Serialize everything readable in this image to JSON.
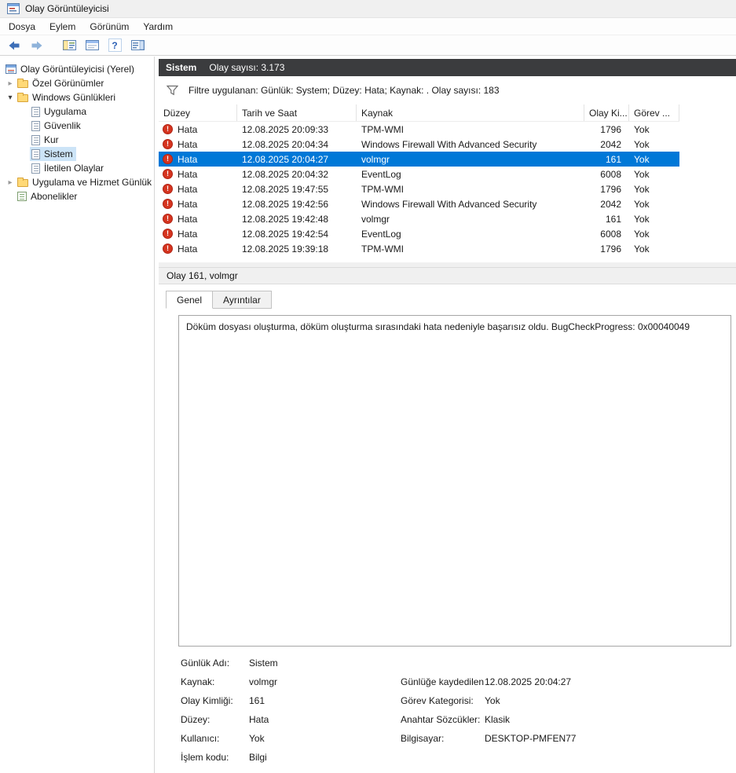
{
  "window": {
    "title": "Olay Görüntüleyicisi"
  },
  "menubar": {
    "items": [
      "Dosya",
      "Eylem",
      "Görünüm",
      "Yardım"
    ]
  },
  "toolbar": {
    "icons": [
      "back-icon",
      "forward-icon",
      "show-console-tree-icon",
      "properties-icon",
      "help-icon",
      "action-pane-icon"
    ]
  },
  "sidebar": {
    "items": [
      {
        "label": "Olay Görüntüleyicisi (Yerel)",
        "level": 0,
        "icon": "event-viewer",
        "expander": "none",
        "selected": false
      },
      {
        "label": "Özel Görünümler",
        "level": 1,
        "icon": "folder",
        "expander": "collapsed",
        "selected": false
      },
      {
        "label": "Windows Günlükleri",
        "level": 1,
        "icon": "folder",
        "expander": "expanded",
        "selected": false
      },
      {
        "label": "Uygulama",
        "level": 2,
        "icon": "log",
        "expander": "none",
        "selected": false
      },
      {
        "label": "Güvenlik",
        "level": 2,
        "icon": "log",
        "expander": "none",
        "selected": false
      },
      {
        "label": "Kur",
        "level": 2,
        "icon": "log",
        "expander": "none",
        "selected": false
      },
      {
        "label": "Sistem",
        "level": 2,
        "icon": "log",
        "expander": "none",
        "selected": true
      },
      {
        "label": "İletilen Olaylar",
        "level": 2,
        "icon": "log",
        "expander": "none",
        "selected": false
      },
      {
        "label": "Uygulama ve Hizmet Günlük",
        "level": 1,
        "icon": "folder",
        "expander": "collapsed",
        "selected": false
      },
      {
        "label": "Abonelikler",
        "level": 1,
        "icon": "subscriptions",
        "expander": "none",
        "selected": false
      }
    ]
  },
  "main": {
    "header": {
      "title": "Sistem",
      "count": "Olay sayısı: 3.173"
    },
    "filter": {
      "text": "Filtre uygulanan: Günlük: System; Düzey: Hata; Kaynak: . Olay sayısı: 183"
    },
    "table": {
      "columns": [
        "Düzey",
        "Tarih ve Saat",
        "Kaynak",
        "Olay Ki...",
        "Görev ..."
      ],
      "rows": [
        {
          "level": "Hata",
          "datetime": "12.08.2025 20:09:33",
          "source": "TPM-WMI",
          "event_id": "1796",
          "task": "Yok",
          "selected": false
        },
        {
          "level": "Hata",
          "datetime": "12.08.2025 20:04:34",
          "source": "Windows Firewall With Advanced Security",
          "event_id": "2042",
          "task": "Yok",
          "selected": false
        },
        {
          "level": "Hata",
          "datetime": "12.08.2025 20:04:27",
          "source": "volmgr",
          "event_id": "161",
          "task": "Yok",
          "selected": true
        },
        {
          "level": "Hata",
          "datetime": "12.08.2025 20:04:32",
          "source": "EventLog",
          "event_id": "6008",
          "task": "Yok",
          "selected": false
        },
        {
          "level": "Hata",
          "datetime": "12.08.2025 19:47:55",
          "source": "TPM-WMI",
          "event_id": "1796",
          "task": "Yok",
          "selected": false
        },
        {
          "level": "Hata",
          "datetime": "12.08.2025 19:42:56",
          "source": "Windows Firewall With Advanced Security",
          "event_id": "2042",
          "task": "Yok",
          "selected": false
        },
        {
          "level": "Hata",
          "datetime": "12.08.2025 19:42:48",
          "source": "volmgr",
          "event_id": "161",
          "task": "Yok",
          "selected": false
        },
        {
          "level": "Hata",
          "datetime": "12.08.2025 19:42:54",
          "source": "EventLog",
          "event_id": "6008",
          "task": "Yok",
          "selected": false
        },
        {
          "level": "Hata",
          "datetime": "12.08.2025 19:39:18",
          "source": "TPM-WMI",
          "event_id": "1796",
          "task": "Yok",
          "selected": false
        }
      ]
    }
  },
  "detail": {
    "header": "Olay 161, volmgr",
    "tabs": [
      {
        "label": "Genel",
        "active": true
      },
      {
        "label": "Ayrıntılar",
        "active": false
      }
    ],
    "description": "Döküm dosyası oluşturma, döküm oluşturma sırasındaki hata nedeniyle başarısız oldu. BugCheckProgress: 0x00040049",
    "fields": [
      {
        "label": "Günlük Adı:",
        "value": "Sistem",
        "label2": "",
        "value2": ""
      },
      {
        "label": "Kaynak:",
        "value": "volmgr",
        "label2": "Günlüğe kaydedilen:",
        "value2": "12.08.2025 20:04:27"
      },
      {
        "label": "Olay Kimliği:",
        "value": "161",
        "label2": "Görev Kategorisi:",
        "value2": "Yok"
      },
      {
        "label": "Düzey:",
        "value": "Hata",
        "label2": "Anahtar Sözcükler:",
        "value2": "Klasik"
      },
      {
        "label": "Kullanıcı:",
        "value": "Yok",
        "label2": "Bilgisayar:",
        "value2": "DESKTOP-PMFEN77"
      },
      {
        "label": "İşlem kodu:",
        "value": "Bilgi",
        "label2": "",
        "value2": ""
      }
    ]
  },
  "colors": {
    "selection": "#0078d7",
    "error": "#d5341f",
    "header_bar": "#3b3c3e"
  }
}
